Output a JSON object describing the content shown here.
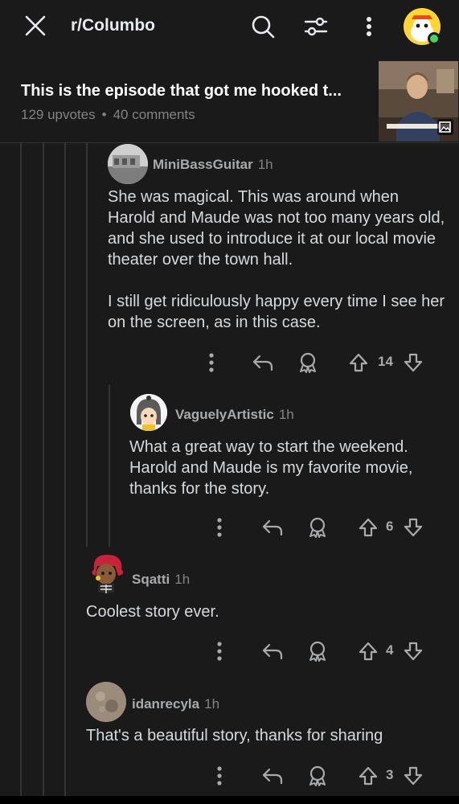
{
  "header": {
    "subreddit": "r/Columbo",
    "icons": [
      "close-icon",
      "search-icon",
      "sort-filter-icon",
      "more-vertical-icon",
      "user-avatar"
    ],
    "colors": {
      "background": "#1a1a1b",
      "online": "#46d160",
      "avatar": "#ffd635"
    }
  },
  "post": {
    "title": "This is the episode that got me hooked t...",
    "upvotes": "129 upvotes",
    "separator": "•",
    "comments": "40 comments"
  },
  "comments": [
    {
      "user": "MiniBassGuitar",
      "time": "1h",
      "paragraphs": [
        "She was magical. This was around when Harold and Maude was not too many years old, and she used to introduce it at our local movie theater over the town hall.",
        "I still get ridiculously happy every time I see her on the screen, as in this case."
      ],
      "votes": "14"
    },
    {
      "user": "VaguelyArtistic",
      "time": "1h",
      "paragraphs": [
        "What a great way to start the weekend. Harold and Maude is my favorite movie, thanks for the story."
      ],
      "votes": "6"
    },
    {
      "user": "Sqatti",
      "time": "1h",
      "paragraphs": [
        "Coolest story ever."
      ],
      "votes": "4"
    },
    {
      "user": "idanrecyla",
      "time": "1h",
      "paragraphs": [
        "That's a beautiful story, thanks for sharing"
      ],
      "votes": "3"
    }
  ]
}
